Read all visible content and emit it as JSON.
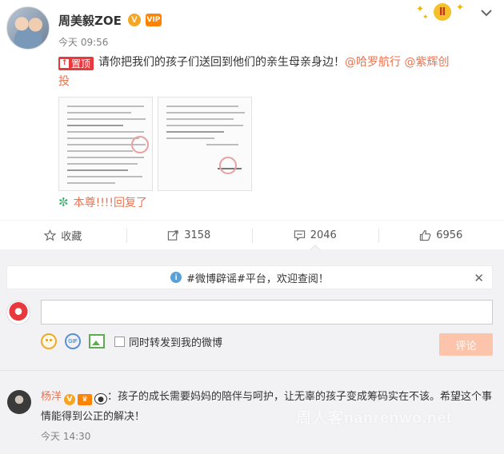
{
  "post": {
    "author": "周美毅ZOE",
    "verified_badge": "V",
    "vip_badge": "VIP",
    "time": "今天 09:56",
    "corner_badge_icon": "gemini-zodiac-icon",
    "pin_label": "置顶",
    "text": "请你把我们的孩子们送回到他们的亲生母亲身边！",
    "mention_1": "@哈罗航行",
    "mention_2_part1": "@紫辉创",
    "mention_2_part2": "投",
    "reply_note": "本尊!!!!回复了"
  },
  "actions": {
    "favorite_label": "收藏",
    "repost_count": "3158",
    "comment_count": "2046",
    "like_count": "6956"
  },
  "comment_box": {
    "rumor_text": "#微博辟谣#平台，欢迎查阅！",
    "input_value": "",
    "repost_checkbox_label": "同时转发到我的微博",
    "submit_label": "评论"
  },
  "comments": [
    {
      "user": "杨洋",
      "text": "：孩子的成长需要妈妈的陪伴与呵护，让无辜的孩子变成筹码实在不该。希望这个事情能得到公正的解决！",
      "time": "今天 14:30"
    }
  ],
  "watermark": "周人客nanrenwo.net",
  "colors": {
    "accent": "#eb7350",
    "pin_red": "#e8393f",
    "submit_disabled": "#fdc4ac",
    "comment_bg": "#f2f2f5"
  }
}
